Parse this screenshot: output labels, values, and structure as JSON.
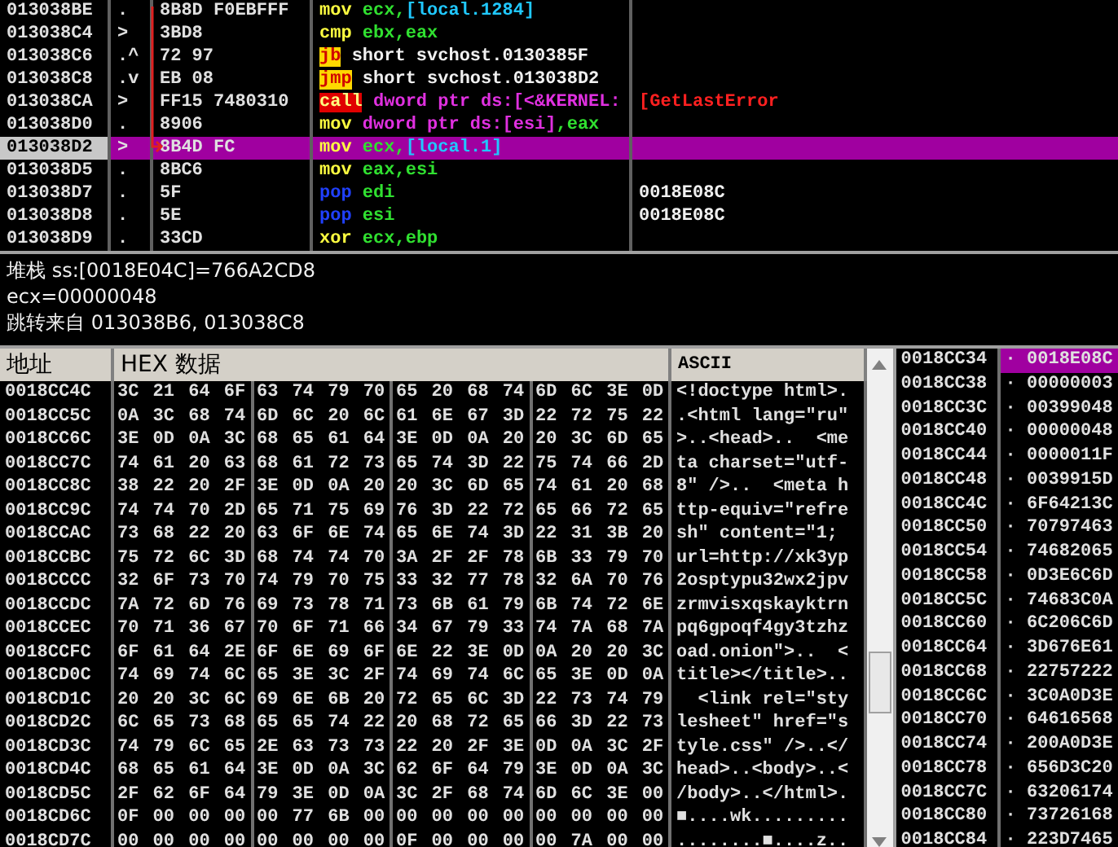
{
  "disassembly": {
    "rows": [
      {
        "address": "013038BE",
        "mark": ".",
        "bytes": "8B8D F0EBFFF",
        "mnemonic": "mov",
        "kind": "plain",
        "operands": [
          {
            "text": "ecx",
            "kind": "reg"
          },
          {
            "text": ",",
            "kind": "punct"
          },
          {
            "text": "[local.1284]",
            "kind": "mem"
          }
        ],
        "selected": false
      },
      {
        "address": "013038C4",
        "mark": ">",
        "bytes": "3BD8",
        "mnemonic": "cmp",
        "kind": "plain",
        "operands": [
          {
            "text": "ebx",
            "kind": "reg"
          },
          {
            "text": ",",
            "kind": "punct"
          },
          {
            "text": "eax",
            "kind": "reg"
          }
        ],
        "selected": false
      },
      {
        "address": "013038C6",
        "mark": ".^",
        "bytes": "72 97",
        "mnemonic": "jb",
        "kind": "jump",
        "operands": [
          {
            "text": "short svchost.0130385F",
            "kind": "text"
          }
        ],
        "selected": false
      },
      {
        "address": "013038C8",
        "mark": ".v",
        "bytes": "EB 08",
        "mnemonic": "jmp",
        "kind": "jump",
        "operands": [
          {
            "text": "short svchost.013038D2",
            "kind": "text"
          }
        ],
        "selected": false
      },
      {
        "address": "013038CA",
        "mark": ">",
        "bytes": "FF15 7480310",
        "mnemonic": "call",
        "kind": "call",
        "operands": [
          {
            "text": "dword ptr ds:[<&KERNEL:",
            "kind": "ptr"
          }
        ],
        "comment": {
          "text": "[GetLastError",
          "kind": "api"
        },
        "selected": false
      },
      {
        "address": "013038D0",
        "mark": ".",
        "bytes": "8906",
        "mnemonic": "mov",
        "kind": "plain",
        "operands": [
          {
            "text": "dword ptr ds:[esi]",
            "kind": "ptr"
          },
          {
            "text": ",",
            "kind": "punct"
          },
          {
            "text": "eax",
            "kind": "reg"
          }
        ],
        "selected": false
      },
      {
        "address": "013038D2",
        "mark": ">",
        "bytes": "8B4D FC",
        "mnemonic": "mov",
        "kind": "plain",
        "operands": [
          {
            "text": "ecx",
            "kind": "reg"
          },
          {
            "text": ",",
            "kind": "punct"
          },
          {
            "text": "[local.1]",
            "kind": "mem"
          }
        ],
        "selected": true
      },
      {
        "address": "013038D5",
        "mark": ".",
        "bytes": "8BC6",
        "mnemonic": "mov",
        "kind": "plain",
        "operands": [
          {
            "text": "eax",
            "kind": "reg"
          },
          {
            "text": ",",
            "kind": "punct"
          },
          {
            "text": "esi",
            "kind": "reg"
          }
        ],
        "selected": false
      },
      {
        "address": "013038D7",
        "mark": ".",
        "bytes": "5F",
        "mnemonic": "pop",
        "kind": "stack",
        "operands": [
          {
            "text": "edi",
            "kind": "reg"
          }
        ],
        "comment": {
          "text": "0018E08C",
          "kind": "plain"
        },
        "selected": false
      },
      {
        "address": "013038D8",
        "mark": ".",
        "bytes": "5E",
        "mnemonic": "pop",
        "kind": "stack",
        "operands": [
          {
            "text": "esi",
            "kind": "reg"
          }
        ],
        "comment": {
          "text": "0018E08C",
          "kind": "plain"
        },
        "selected": false
      },
      {
        "address": "013038D9",
        "mark": ".",
        "bytes": "33CD",
        "mnemonic": "xor",
        "kind": "plain",
        "operands": [
          {
            "text": "ecx",
            "kind": "reg"
          },
          {
            "text": ",",
            "kind": "punct"
          },
          {
            "text": "ebp",
            "kind": "reg"
          }
        ],
        "selected": false
      }
    ]
  },
  "info": {
    "lines": [
      "堆栈 ss:[0018E04C]=766A2CD8",
      "ecx=00000048",
      "跳转来自 013038B6, 013038C8"
    ]
  },
  "dump": {
    "columns": [
      "地址",
      "HEX 数据",
      "ASCII"
    ],
    "rows": [
      {
        "address": "0018CC4C",
        "hex": "3C 21 64 6F 63 74 79 70 65 20 68 74 6D 6C 3E 0D",
        "ascii": "<!doctype html>."
      },
      {
        "address": "0018CC5C",
        "hex": "0A 3C 68 74 6D 6C 20 6C 61 6E 67 3D 22 72 75 22",
        "ascii": ".<html lang=\"ru\""
      },
      {
        "address": "0018CC6C",
        "hex": "3E 0D 0A 3C 68 65 61 64 3E 0D 0A 20 20 3C 6D 65",
        "ascii": ">..<head>..  <me"
      },
      {
        "address": "0018CC7C",
        "hex": "74 61 20 63 68 61 72 73 65 74 3D 22 75 74 66 2D",
        "ascii": "ta charset=\"utf-"
      },
      {
        "address": "0018CC8C",
        "hex": "38 22 20 2F 3E 0D 0A 20 20 3C 6D 65 74 61 20 68",
        "ascii": "8\" />..  <meta h"
      },
      {
        "address": "0018CC9C",
        "hex": "74 74 70 2D 65 71 75 69 76 3D 22 72 65 66 72 65",
        "ascii": "ttp-equiv=\"refre"
      },
      {
        "address": "0018CCAC",
        "hex": "73 68 22 20 63 6F 6E 74 65 6E 74 3D 22 31 3B 20",
        "ascii": "sh\" content=\"1; "
      },
      {
        "address": "0018CCBC",
        "hex": "75 72 6C 3D 68 74 74 70 3A 2F 2F 78 6B 33 79 70",
        "ascii": "url=http://xk3yp"
      },
      {
        "address": "0018CCCC",
        "hex": "32 6F 73 70 74 79 70 75 33 32 77 78 32 6A 70 76",
        "ascii": "2osptypu32wx2jpv"
      },
      {
        "address": "0018CCDC",
        "hex": "7A 72 6D 76 69 73 78 71 73 6B 61 79 6B 74 72 6E",
        "ascii": "zrmvisxqskayktrn"
      },
      {
        "address": "0018CCEC",
        "hex": "70 71 36 67 70 6F 71 66 34 67 79 33 74 7A 68 7A",
        "ascii": "pq6gpoqf4gy3tzhz"
      },
      {
        "address": "0018CCFC",
        "hex": "6F 61 64 2E 6F 6E 69 6F 6E 22 3E 0D 0A 20 20 3C",
        "ascii": "oad.onion\">..  <"
      },
      {
        "address": "0018CD0C",
        "hex": "74 69 74 6C 65 3E 3C 2F 74 69 74 6C 65 3E 0D 0A",
        "ascii": "title></title>.."
      },
      {
        "address": "0018CD1C",
        "hex": "20 20 3C 6C 69 6E 6B 20 72 65 6C 3D 22 73 74 79",
        "ascii": "  <link rel=\"sty"
      },
      {
        "address": "0018CD2C",
        "hex": "6C 65 73 68 65 65 74 22 20 68 72 65 66 3D 22 73",
        "ascii": "lesheet\" href=\"s"
      },
      {
        "address": "0018CD3C",
        "hex": "74 79 6C 65 2E 63 73 73 22 20 2F 3E 0D 0A 3C 2F",
        "ascii": "tyle.css\" />..</"
      },
      {
        "address": "0018CD4C",
        "hex": "68 65 61 64 3E 0D 0A 3C 62 6F 64 79 3E 0D 0A 3C",
        "ascii": "head>..<body>..<"
      },
      {
        "address": "0018CD5C",
        "hex": "2F 62 6F 64 79 3E 0D 0A 3C 2F 68 74 6D 6C 3E 00",
        "ascii": "/body>..</html>."
      },
      {
        "address": "0018CD6C",
        "hex": "0F 00 00 00 00 77 6B 00 00 00 00 00 00 00 00 00",
        "ascii": "■....wk........."
      },
      {
        "address": "0018CD7C",
        "hex": "00 00 00 00 00 00 00 00 0F 00 00 00 00 7A 00 00",
        "ascii": "........■....z.."
      }
    ]
  },
  "stack": {
    "rows": [
      {
        "address": "0018CC34",
        "marker": "·",
        "value": "0018E08C",
        "selected": true
      },
      {
        "address": "0018CC38",
        "marker": "·",
        "value": "00000003",
        "selected": false
      },
      {
        "address": "0018CC3C",
        "marker": "·",
        "value": "00399048",
        "selected": false
      },
      {
        "address": "0018CC40",
        "marker": "·",
        "value": "00000048",
        "selected": false
      },
      {
        "address": "0018CC44",
        "marker": "·",
        "value": "0000011F",
        "selected": false
      },
      {
        "address": "0018CC48",
        "marker": "·",
        "value": "0039915D",
        "selected": false
      },
      {
        "address": "0018CC4C",
        "marker": "·",
        "value": "6F64213C",
        "selected": false
      },
      {
        "address": "0018CC50",
        "marker": "·",
        "value": "70797463",
        "selected": false
      },
      {
        "address": "0018CC54",
        "marker": "·",
        "value": "74682065",
        "selected": false
      },
      {
        "address": "0018CC58",
        "marker": "·",
        "value": "0D3E6C6D",
        "selected": false
      },
      {
        "address": "0018CC5C",
        "marker": "·",
        "value": "74683C0A",
        "selected": false
      },
      {
        "address": "0018CC60",
        "marker": "·",
        "value": "6C206C6D",
        "selected": false
      },
      {
        "address": "0018CC64",
        "marker": "·",
        "value": "3D676E61",
        "selected": false
      },
      {
        "address": "0018CC68",
        "marker": "·",
        "value": "22757222",
        "selected": false
      },
      {
        "address": "0018CC6C",
        "marker": "·",
        "value": "3C0A0D3E",
        "selected": false
      },
      {
        "address": "0018CC70",
        "marker": "·",
        "value": "64616568",
        "selected": false
      },
      {
        "address": "0018CC74",
        "marker": "·",
        "value": "200A0D3E",
        "selected": false
      },
      {
        "address": "0018CC78",
        "marker": "·",
        "value": "656D3C20",
        "selected": false
      },
      {
        "address": "0018CC7C",
        "marker": "·",
        "value": "63206174",
        "selected": false
      },
      {
        "address": "0018CC80",
        "marker": "·",
        "value": "73726168",
        "selected": false
      },
      {
        "address": "0018CC84",
        "marker": "·",
        "value": "223D7465",
        "selected": false
      }
    ]
  }
}
